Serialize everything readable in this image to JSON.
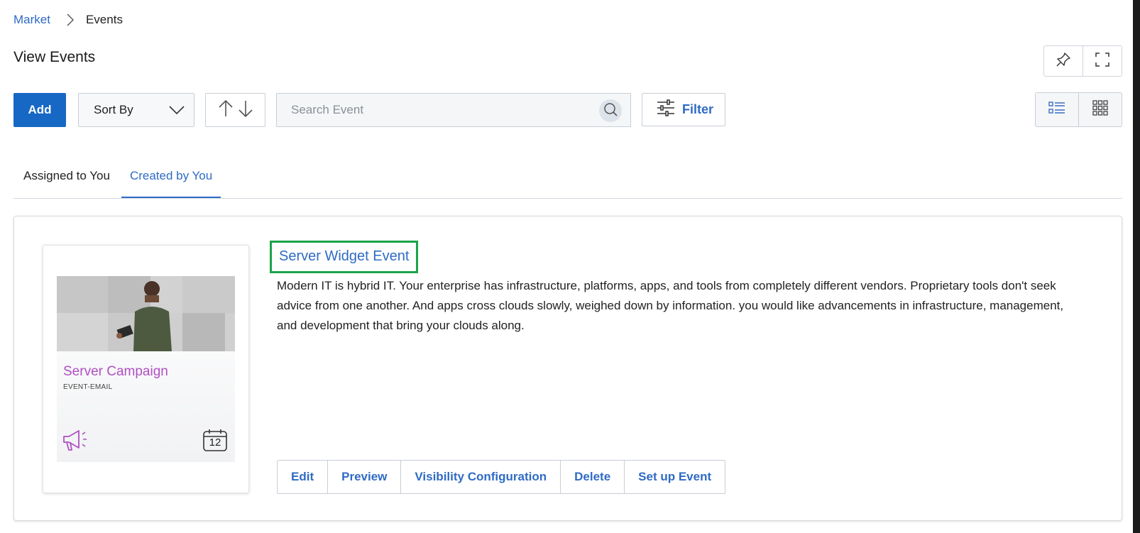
{
  "breadcrumb": {
    "root": "Market",
    "current": "Events"
  },
  "page": {
    "title": "View Events"
  },
  "toolbar": {
    "add_label": "Add",
    "sort_label": "Sort By",
    "search_placeholder": "Search Event",
    "filter_label": "Filter"
  },
  "tabs": [
    {
      "label": "Assigned to You",
      "active": false
    },
    {
      "label": "Created by You",
      "active": true
    }
  ],
  "event": {
    "title": "Server Widget Event",
    "description": "Modern IT is hybrid IT. Your enterprise has infrastructure, platforms, apps, and tools from completely different vendors. Proprietary tools don't seek advice from one another. And apps cross clouds slowly, weighed down by information. you would like advancements in infrastructure, management, and development that bring your clouds along.",
    "campaign_title": "Server Campaign",
    "campaign_type": "EVENT-EMAIL",
    "calendar_day": "12",
    "actions": [
      "Edit",
      "Preview",
      "Visibility Configuration",
      "Delete",
      "Set up Event"
    ]
  },
  "colors": {
    "primary": "#1668c4",
    "link": "#2f6bc4",
    "campaign_accent": "#b04fc4",
    "highlight_border": "#1aa34a"
  },
  "icons": [
    "chevron-right-icon",
    "pin-icon",
    "fullscreen-icon",
    "chevron-down-icon",
    "arrow-up-icon",
    "arrow-down-icon",
    "search-icon",
    "sliders-icon",
    "list-view-icon",
    "grid-view-icon",
    "megaphone-icon",
    "calendar-icon"
  ]
}
